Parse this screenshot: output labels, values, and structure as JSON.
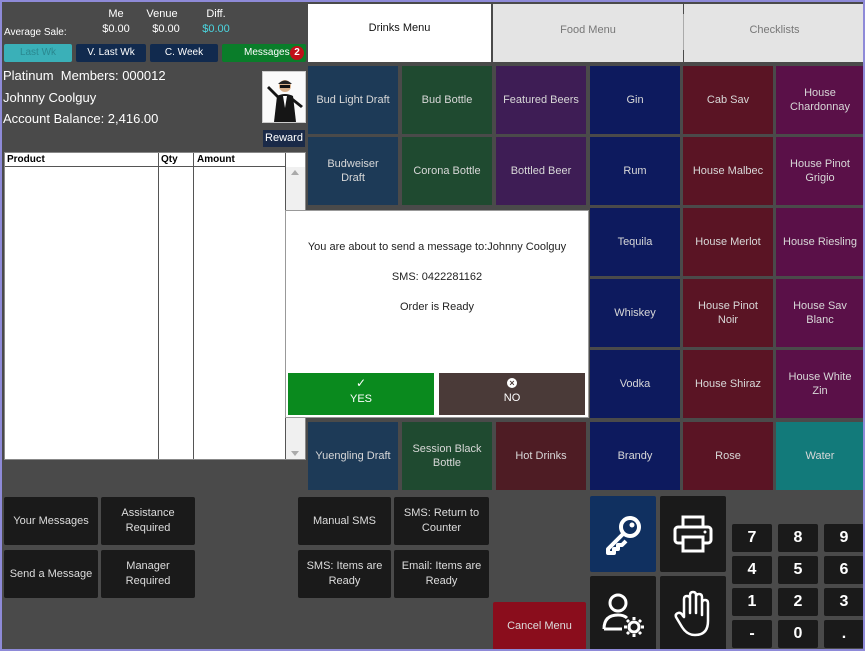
{
  "stats": {
    "average_sale_label": "Average Sale:",
    "me_label": "Me",
    "me_value": "$0.00",
    "venue_label": "Venue",
    "venue_value": "$0.00",
    "diff_label": "Diff.",
    "diff_value": "$0.00"
  },
  "pills": {
    "hidden_label": "Last Wk",
    "v_last_wk": "V. Last Wk",
    "c_week": "C. Week",
    "messages": "Messages",
    "messages_count": "2"
  },
  "member": {
    "tier_line": "Platinum  Members: 000012",
    "name": "Johnny Coolguy",
    "balance": "Account Balance: 2,416.00",
    "reward_label": "Reward"
  },
  "table": {
    "headers": [
      "Product",
      "Qty",
      "Amount"
    ]
  },
  "tabs": [
    "Drinks Menu",
    "Food Menu",
    "Checklists"
  ],
  "grid": {
    "col1": [
      "Bud Light Draft",
      "Budweiser Draft",
      "",
      "",
      "",
      "Yuengling Draft"
    ],
    "col2": [
      "Bud Bottle",
      "Corona Bottle",
      "",
      "",
      "",
      "Session Black Bottle"
    ],
    "col3": [
      "Featured Beers",
      "Bottled Beer",
      "",
      "",
      "",
      "Hot Drinks"
    ],
    "col4": [
      "Gin",
      "Rum",
      "Tequila",
      "Whiskey",
      "Vodka",
      "Brandy"
    ],
    "col5": [
      "Cab Sav",
      "House Malbec",
      "House Merlot",
      "House Pinot Noir",
      "House Shiraz",
      "Rose"
    ],
    "col6": [
      "House Chardonnay",
      "House Pinot Grigio",
      "House Riesling",
      "House Sav Blanc",
      "House White Zin",
      "Water"
    ]
  },
  "dialog": {
    "line1": "You are about to send a message to:Johnny  Coolguy",
    "line2": "SMS: 0422281162",
    "line3": "Order is Ready",
    "yes_label": "YES",
    "no_label": "NO"
  },
  "bottom": {
    "your_messages": "Your Messages",
    "assistance_required": "Assistance Required",
    "send_message": "Send a Message",
    "manager_required": "Manager Required",
    "manual_sms": "Manual SMS",
    "sms_return": "SMS: Return to Counter",
    "sms_items_ready": "SMS: Items are Ready",
    "email_items_ready": "Email: Items are Ready",
    "cancel_menu": "Cancel Menu"
  },
  "keypad": [
    "7",
    "8",
    "9",
    "4",
    "5",
    "6",
    "1",
    "2",
    "3",
    "-",
    "0",
    "."
  ],
  "colors": {
    "yes_green": "#0a8a1e",
    "no_brown": "#4a3a38",
    "cancel_red": "#8a0d1c",
    "key_blue": "#103060"
  }
}
